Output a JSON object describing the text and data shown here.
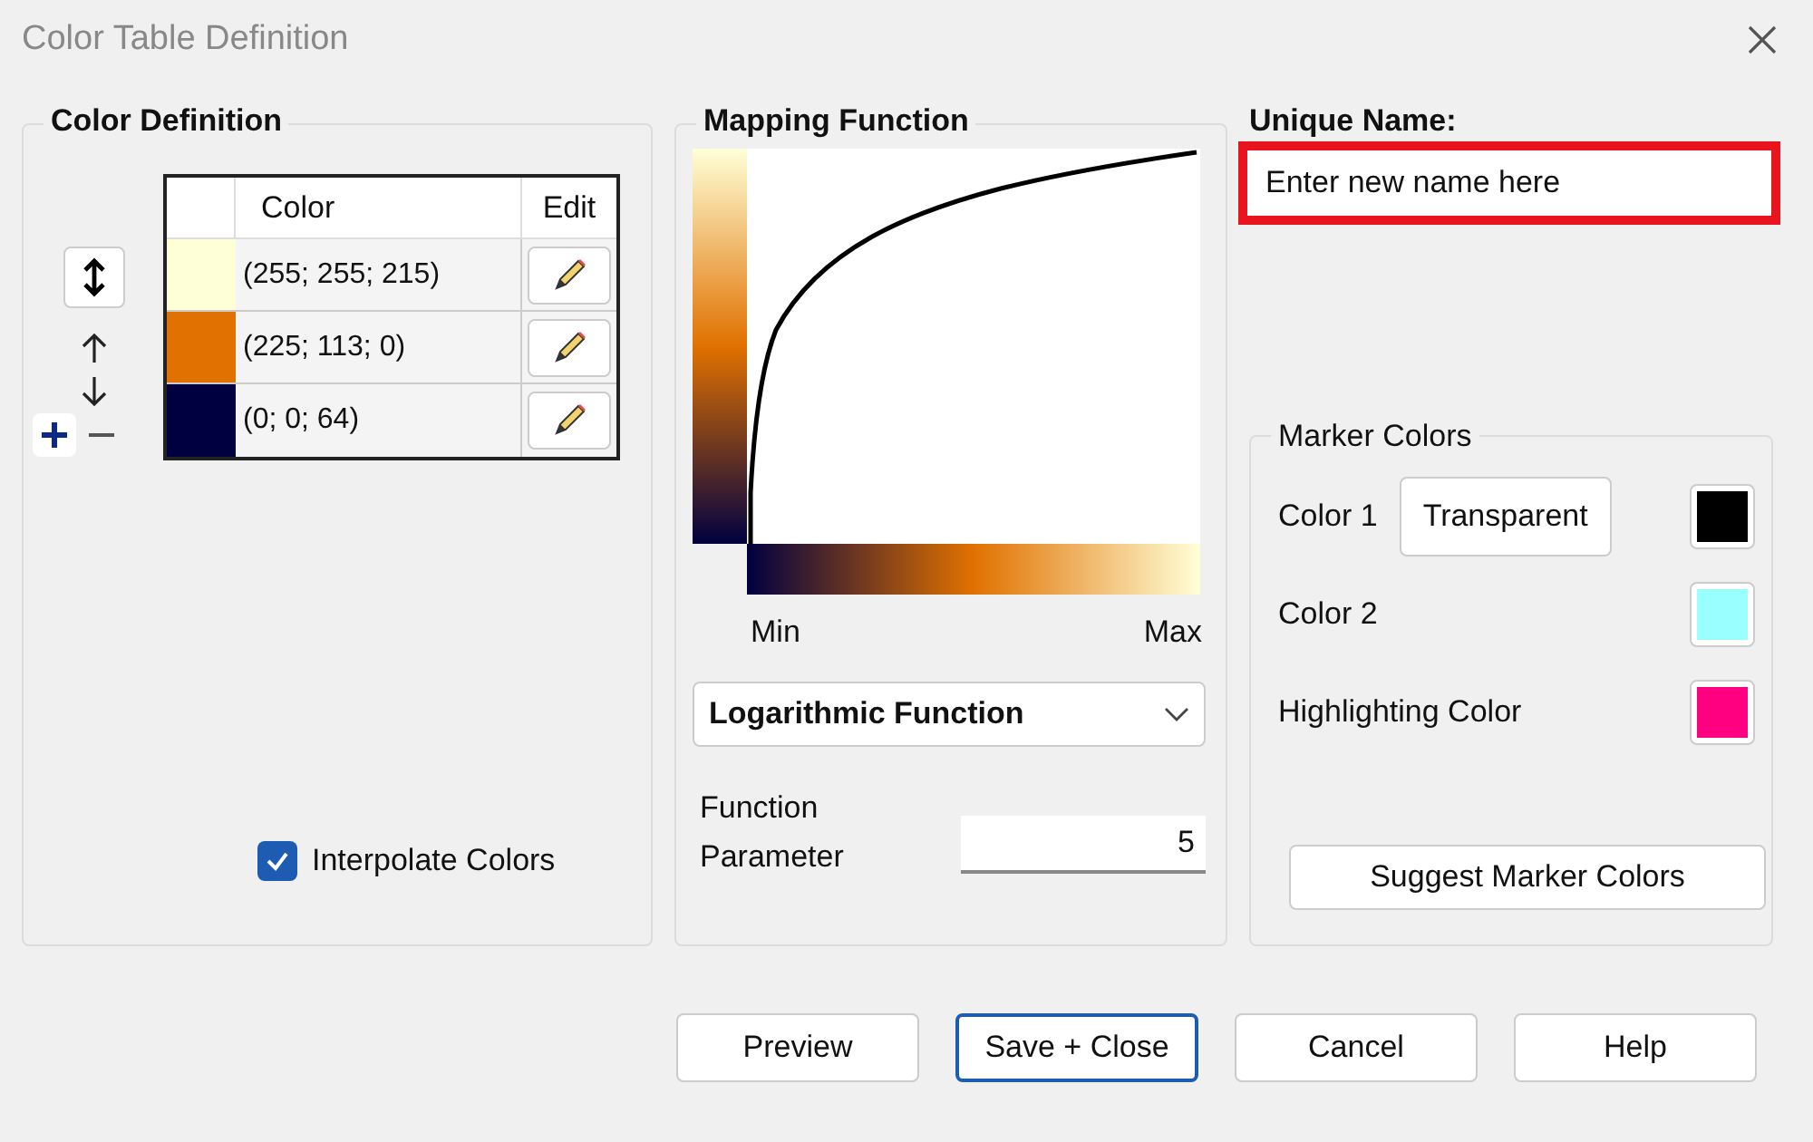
{
  "window": {
    "title": "Color Table Definition"
  },
  "color_definition": {
    "title": "Color Definition",
    "columns": [
      "Color",
      "Edit"
    ],
    "rows": [
      {
        "color": "#ffffd7",
        "value": "(255; 255; 215)"
      },
      {
        "color": "#e17100",
        "value": "(225; 113; 0)"
      },
      {
        "color": "#000040",
        "value": "(0; 0; 64)"
      }
    ],
    "interpolate": {
      "label": "Interpolate Colors",
      "checked": true
    }
  },
  "mapping_function": {
    "title": "Mapping Function",
    "min_label": "Min",
    "max_label": "Max",
    "function": "Logarithmic Function",
    "parameter_label": "Function Parameter",
    "parameter_value": "5"
  },
  "unique_name": {
    "label": "Unique Name:",
    "value": "Enter new name here",
    "highlighted": true
  },
  "marker_colors": {
    "title": "Marker Colors",
    "items": [
      {
        "label": "Color 1",
        "button": "Transparent",
        "color": "#000000"
      },
      {
        "label": "Color 2",
        "color": "#99ffff"
      },
      {
        "label": "Highlighting Color",
        "color": "#ff0080"
      }
    ],
    "suggest_button": "Suggest Marker Colors"
  },
  "buttons": [
    {
      "label": "Preview",
      "default": false
    },
    {
      "label": "Save + Close",
      "default": true
    },
    {
      "label": "Cancel",
      "default": false
    },
    {
      "label": "Help",
      "default": false
    }
  ]
}
